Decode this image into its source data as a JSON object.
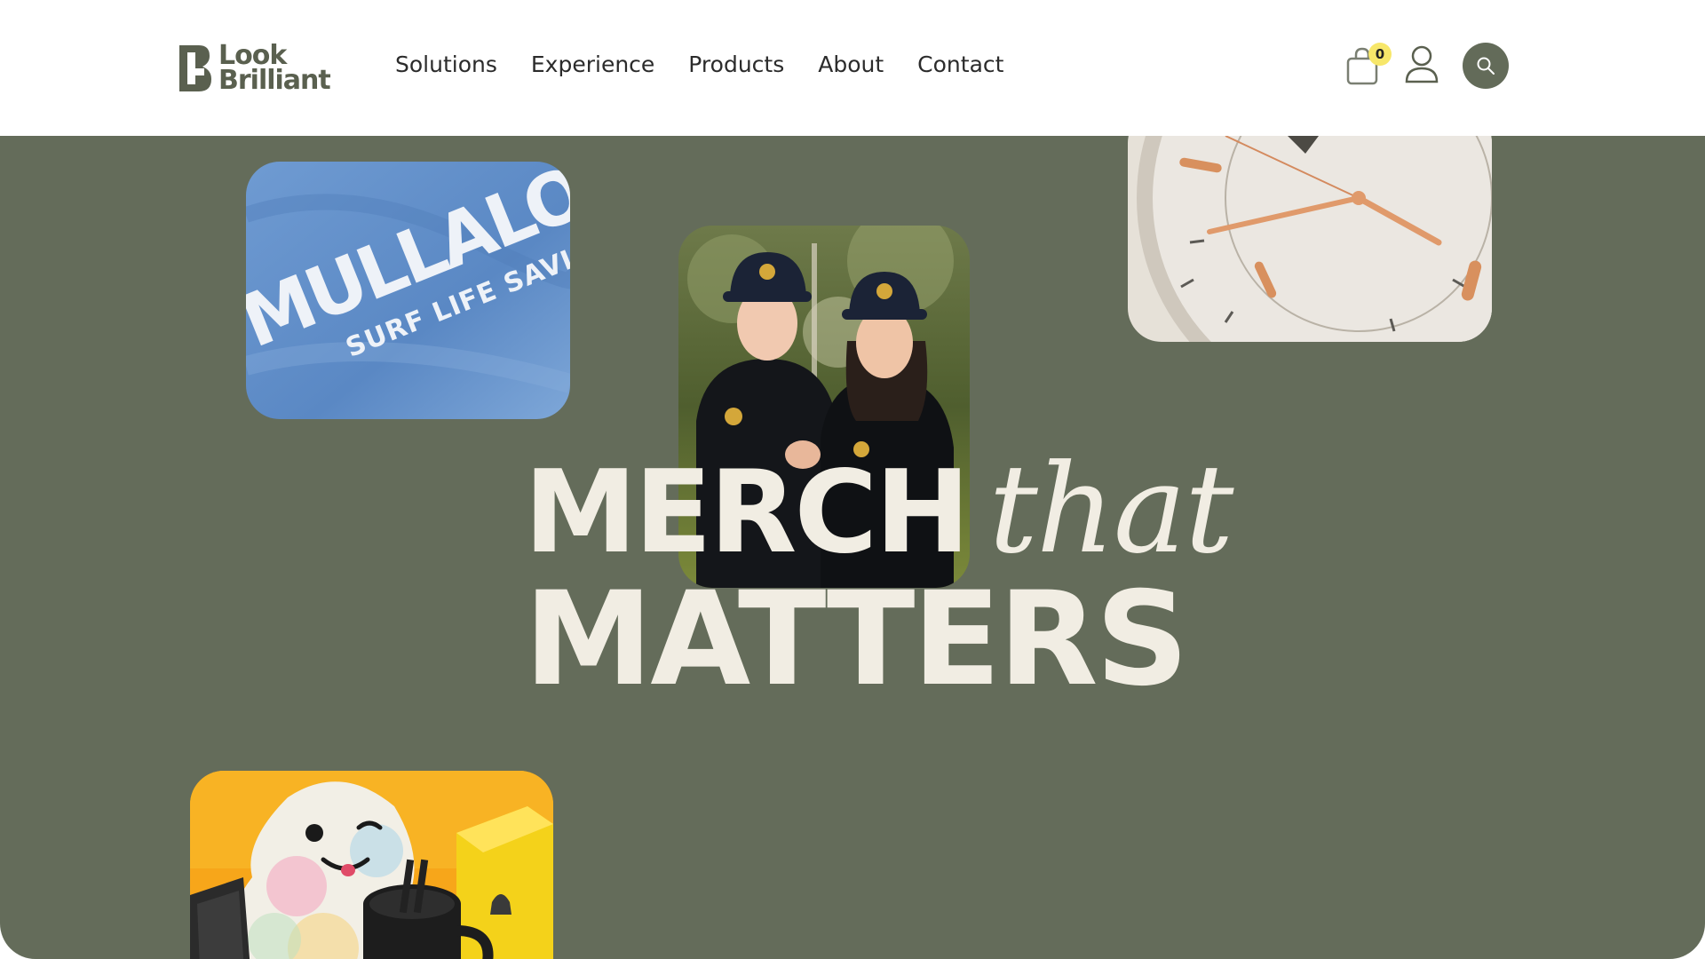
{
  "brand": {
    "line1": "Look",
    "line2": "Brilliant",
    "color": "#5a604f"
  },
  "nav": {
    "items": [
      {
        "label": "Solutions"
      },
      {
        "label": "Experience"
      },
      {
        "label": "Products"
      },
      {
        "label": "About"
      },
      {
        "label": "Contact"
      }
    ]
  },
  "header": {
    "cart_count": "0",
    "cart_icon": "shopping-bag-icon",
    "user_icon": "user-icon",
    "search_icon": "search-icon",
    "accent": "#636b59",
    "badge_color": "#f7e76a"
  },
  "hero": {
    "background": "#646c5a",
    "headline_word1": "MERCH",
    "headline_word2": "that",
    "headline_word3": "MATTERS",
    "headline_color": "#f1ede3",
    "shirt_print_big": "MULLALOO",
    "shirt_print_small": "SURF LIFE SAVING"
  }
}
